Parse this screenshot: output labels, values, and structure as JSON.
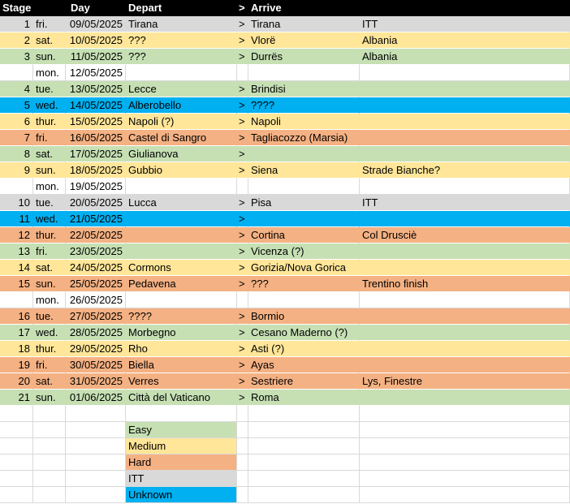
{
  "header": {
    "stage": "Stage",
    "day": "Day",
    "depart": "Depart",
    "arrow": ">",
    "arrive": "Arrive"
  },
  "colors": {
    "easy": "#c6e0b4",
    "medium": "#ffe699",
    "hard": "#f4b183",
    "itt": "#d9d9d9",
    "unknown": "#00b0f0"
  },
  "rows": [
    {
      "stage": "1",
      "dow": "fri.",
      "date": "09/05/2025",
      "depart": "Tirana",
      "arrow": ">",
      "arrive": "Tirana",
      "note": "ITT",
      "type": "itt"
    },
    {
      "stage": "2",
      "dow": "sat.",
      "date": "10/05/2025",
      "depart": "???",
      "arrow": ">",
      "arrive": "Vlorë",
      "note": "Albania",
      "type": "medium"
    },
    {
      "stage": "3",
      "dow": "sun.",
      "date": "11/05/2025",
      "depart": "???",
      "arrow": ">",
      "arrive": "Durrës",
      "note": "Albania",
      "type": "easy"
    },
    {
      "stage": "",
      "dow": "mon.",
      "date": "12/05/2025",
      "depart": "",
      "arrow": "",
      "arrive": "",
      "note": "",
      "type": "rest"
    },
    {
      "stage": "4",
      "dow": "tue.",
      "date": "13/05/2025",
      "depart": "Lecce",
      "arrow": ">",
      "arrive": "Brindisi",
      "note": "",
      "type": "easy"
    },
    {
      "stage": "5",
      "dow": "wed.",
      "date": "14/05/2025",
      "depart": "Alberobello",
      "arrow": ">",
      "arrive": "????",
      "note": "",
      "type": "unknown"
    },
    {
      "stage": "6",
      "dow": "thur.",
      "date": "15/05/2025",
      "depart": "Napoli (?)",
      "arrow": ">",
      "arrive": "Napoli",
      "note": "",
      "type": "medium"
    },
    {
      "stage": "7",
      "dow": "fri.",
      "date": "16/05/2025",
      "depart": "Castel di Sangro",
      "arrow": ">",
      "arrive": "Tagliacozzo (Marsia)",
      "note": "",
      "type": "hard"
    },
    {
      "stage": "8",
      "dow": "sat.",
      "date": "17/05/2025",
      "depart": "Giulianova",
      "arrow": ">",
      "arrive": "",
      "note": "",
      "type": "easy"
    },
    {
      "stage": "9",
      "dow": "sun.",
      "date": "18/05/2025",
      "depart": "Gubbio",
      "arrow": ">",
      "arrive": "Siena",
      "note": "Strade Bianche?",
      "type": "medium"
    },
    {
      "stage": "",
      "dow": "mon.",
      "date": "19/05/2025",
      "depart": "",
      "arrow": "",
      "arrive": "",
      "note": "",
      "type": "rest"
    },
    {
      "stage": "10",
      "dow": "tue.",
      "date": "20/05/2025",
      "depart": "Lucca",
      "arrow": ">",
      "arrive": "Pisa",
      "note": "ITT",
      "type": "itt"
    },
    {
      "stage": "11",
      "dow": "wed.",
      "date": "21/05/2025",
      "depart": "",
      "arrow": ">",
      "arrive": "",
      "note": "",
      "type": "unknown"
    },
    {
      "stage": "12",
      "dow": "thur.",
      "date": "22/05/2025",
      "depart": "",
      "arrow": ">",
      "arrive": "Cortina",
      "note": "Col Drusciè",
      "type": "hard"
    },
    {
      "stage": "13",
      "dow": "fri.",
      "date": "23/05/2025",
      "depart": "",
      "arrow": ">",
      "arrive": "Vicenza (?)",
      "note": "",
      "type": "easy"
    },
    {
      "stage": "14",
      "dow": "sat.",
      "date": "24/05/2025",
      "depart": "Cormons",
      "arrow": ">",
      "arrive": "Gorizia/Nova Gorica",
      "note": "",
      "type": "medium"
    },
    {
      "stage": "15",
      "dow": "sun.",
      "date": "25/05/2025",
      "depart": "Pedavena",
      "arrow": ">",
      "arrive": "???",
      "note": "Trentino finish",
      "type": "hard"
    },
    {
      "stage": "",
      "dow": "mon.",
      "date": "26/05/2025",
      "depart": "",
      "arrow": "",
      "arrive": "",
      "note": "",
      "type": "rest"
    },
    {
      "stage": "16",
      "dow": "tue.",
      "date": "27/05/2025",
      "depart": "????",
      "arrow": ">",
      "arrive": "Bormio",
      "note": "",
      "type": "hard"
    },
    {
      "stage": "17",
      "dow": "wed.",
      "date": "28/05/2025",
      "depart": "Morbegno",
      "arrow": ">",
      "arrive": "Cesano Maderno (?)",
      "note": "",
      "type": "easy"
    },
    {
      "stage": "18",
      "dow": "thur.",
      "date": "29/05/2025",
      "depart": "Rho",
      "arrow": ">",
      "arrive": "Asti (?)",
      "note": "",
      "type": "medium"
    },
    {
      "stage": "19",
      "dow": "fri.",
      "date": "30/05/2025",
      "depart": "Biella",
      "arrow": ">",
      "arrive": "Ayas",
      "note": "",
      "type": "hard"
    },
    {
      "stage": "20",
      "dow": "sat.",
      "date": "31/05/2025",
      "depart": "Verres",
      "arrow": ">",
      "arrive": "Sestriere",
      "note": "Lys, Finestre",
      "type": "hard"
    },
    {
      "stage": "21",
      "dow": "sun.",
      "date": "01/06/2025",
      "depart": "Città del Vaticano",
      "arrow": ">",
      "arrive": "Roma",
      "note": "",
      "type": "easy"
    }
  ],
  "legend": [
    {
      "label": "Easy",
      "type": "easy"
    },
    {
      "label": "Medium",
      "type": "medium"
    },
    {
      "label": "Hard",
      "type": "hard"
    },
    {
      "label": "ITT",
      "type": "itt"
    },
    {
      "label": "Unknown",
      "type": "unknown"
    }
  ]
}
